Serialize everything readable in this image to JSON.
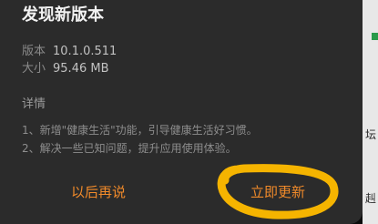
{
  "dialog": {
    "title": "发现新版本",
    "version_label": "版本",
    "version_value": "10.1.0.511",
    "size_label": "大小",
    "size_value": "95.46 MB",
    "details_title": "详情",
    "notes": [
      "1、新增\"健康生活\"功能，引导健康生活好习惯。",
      "2、解决一些已知问题，提升应用使用体验。"
    ],
    "later_button": "以后再说",
    "update_button": "立即更新"
  },
  "annotation": {
    "circle_color": "#f5b400"
  }
}
